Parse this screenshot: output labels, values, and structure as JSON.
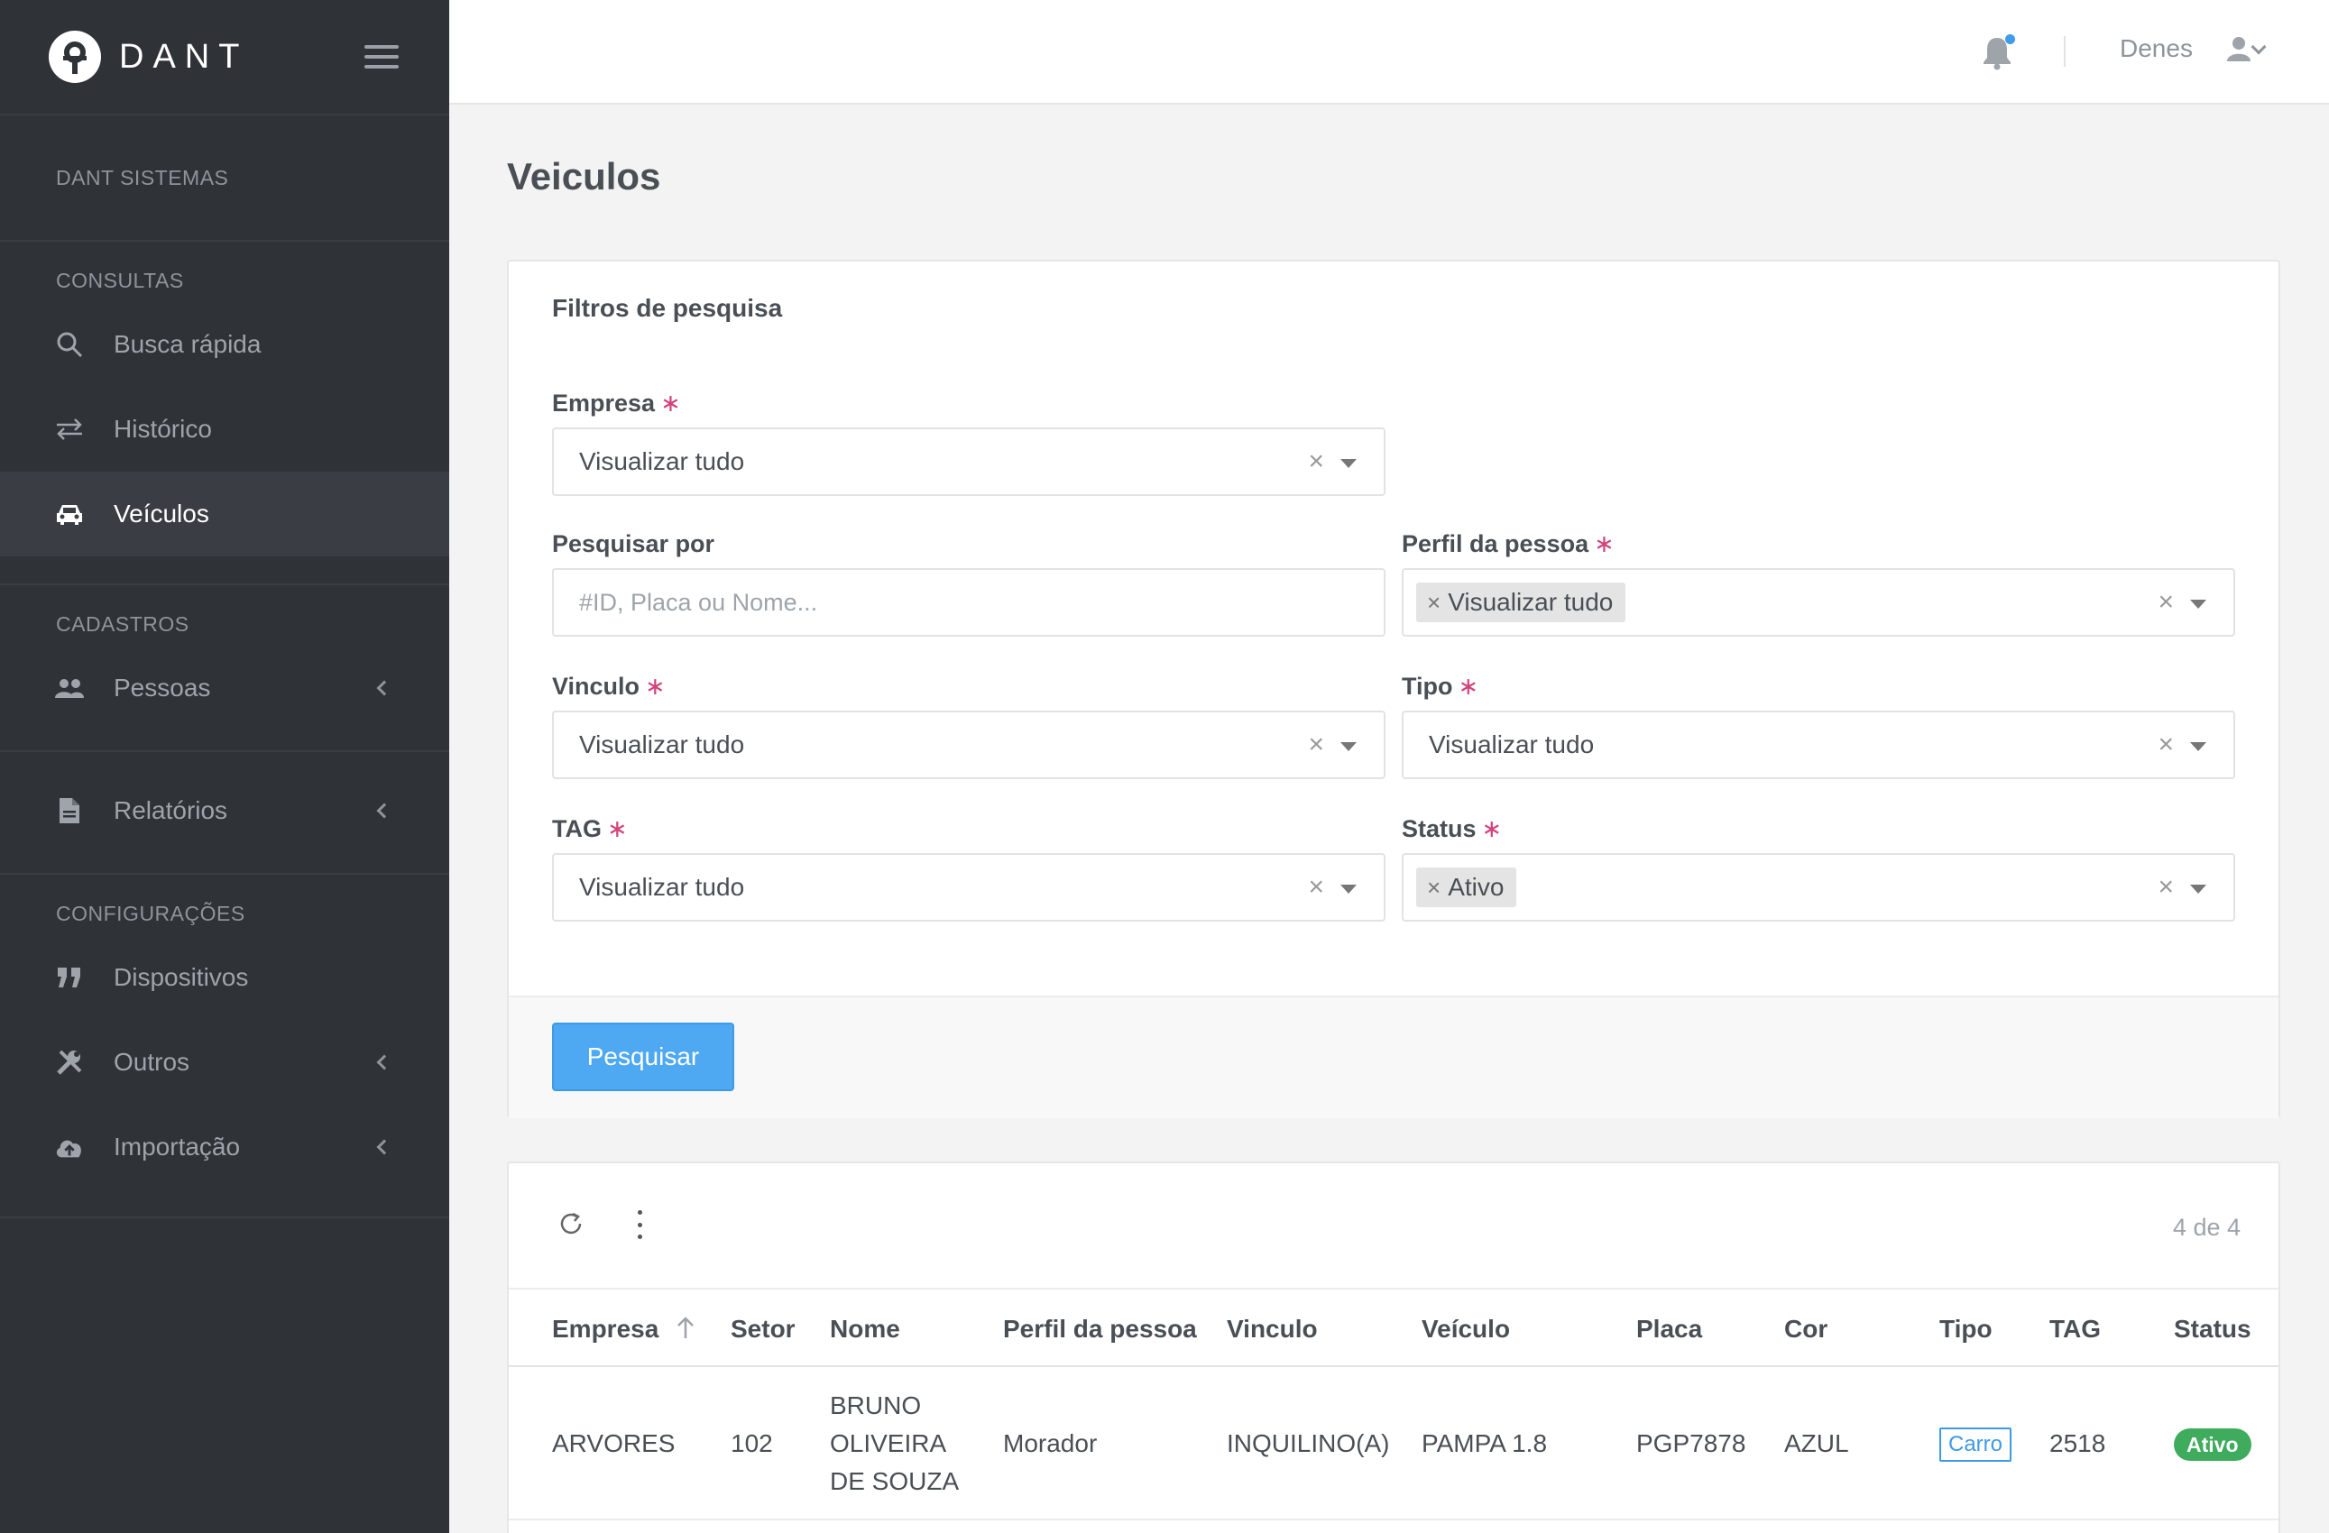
{
  "brand": {
    "name": "DANT"
  },
  "sidebar": {
    "company": "DANT SISTEMAS",
    "sections": [
      {
        "heading": "CONSULTAS",
        "items": [
          {
            "label": "Busca rápida",
            "icon": "search-icon"
          },
          {
            "label": "Histórico",
            "icon": "arrows-swap-icon"
          },
          {
            "label": "Veículos",
            "icon": "car-icon",
            "active": true
          }
        ]
      },
      {
        "heading": "CADASTROS",
        "items": [
          {
            "label": "Pessoas",
            "icon": "people-icon"
          }
        ]
      },
      {
        "items": [
          {
            "label": "Relatórios",
            "icon": "document-icon"
          }
        ]
      },
      {
        "heading": "CONFIGURAÇÕES",
        "items": [
          {
            "label": "Dispositivos",
            "icon": "quote-icon"
          },
          {
            "label": "Outros",
            "icon": "tools-icon"
          },
          {
            "label": "Importação",
            "icon": "cloud-upload-icon"
          }
        ]
      }
    ]
  },
  "header": {
    "user_name": "Denes"
  },
  "page": {
    "title": "Veiculos"
  },
  "filters": {
    "title": "Filtros de pesquisa",
    "empresa": {
      "label": "Empresa",
      "value": "Visualizar tudo"
    },
    "pesquisar_por": {
      "label": "Pesquisar por",
      "placeholder": "#ID, Placa ou Nome..."
    },
    "perfil": {
      "label": "Perfil da pessoa",
      "chip": "Visualizar tudo"
    },
    "vinculo": {
      "label": "Vinculo",
      "value": "Visualizar tudo"
    },
    "tipo": {
      "label": "Tipo",
      "value": "Visualizar tudo"
    },
    "tag": {
      "label": "TAG",
      "value": "Visualizar tudo"
    },
    "status": {
      "label": "Status",
      "chip": "Ativo"
    },
    "required_mark": "∗",
    "clear_glyph": "×",
    "search_button": "Pesquisar"
  },
  "table": {
    "count": "4 de 4",
    "columns": [
      "Empresa",
      "Setor",
      "Nome",
      "Perfil da pessoa",
      "Vinculo",
      "Veículo",
      "Placa",
      "Cor",
      "Tipo",
      "TAG",
      "Status"
    ],
    "rows": [
      {
        "empresa": "ARVORES",
        "setor": "102",
        "nome_lines": [
          "BRUNO",
          "OLIVEIRA",
          "DE SOUZA"
        ],
        "perfil": "Morador",
        "vinculo": "INQUILINO(A)",
        "veiculo": "PAMPA 1.8",
        "placa": "PGP7878",
        "cor": "AZUL",
        "tipo": "Carro",
        "tag": "2518",
        "status": "Ativo"
      }
    ]
  },
  "colors": {
    "sidebar_bg": "#2f3237",
    "primary_button": "#4fa8f2",
    "required": "#d2427b",
    "status_active": "#3fab5c",
    "notification_dot": "#3f9ce8"
  }
}
